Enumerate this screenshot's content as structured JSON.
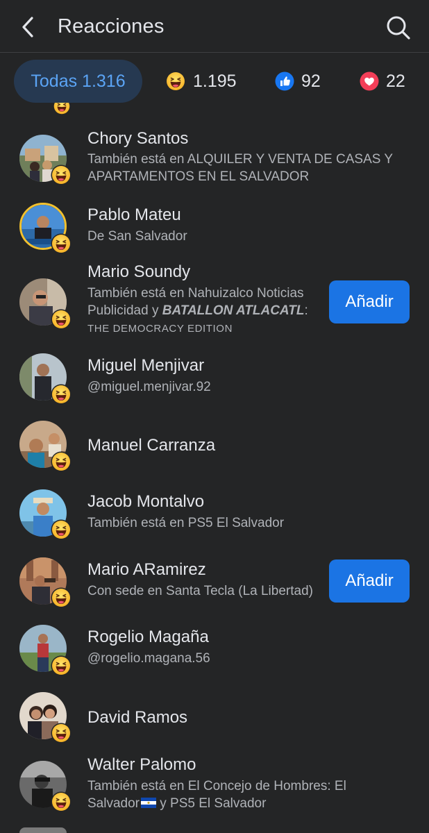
{
  "header": {
    "title": "Reacciones",
    "back_icon": "chevron-left-icon",
    "search_icon": "search-icon"
  },
  "tabs": {
    "all": {
      "label": "Todas 1.316"
    },
    "haha": {
      "count": "1.195",
      "icon": "haha-emoji-icon"
    },
    "like": {
      "count": "92",
      "icon": "like-thumb-icon"
    },
    "love": {
      "count": "22",
      "icon": "heart-icon"
    }
  },
  "colors": {
    "background": "#242526",
    "tab_active_bg": "#263951",
    "tab_active_text": "#5ba4f5",
    "button_blue": "#1b74e4",
    "secondary_text": "#b0b3b8"
  },
  "people": [
    {
      "name": "Chory Santos",
      "subtitle": "También está en ALQUILER Y VENTA DE CASAS Y APARTAMENTOS EN EL SALVADOR"
    },
    {
      "name": "Pablo Mateu",
      "subtitle": "De San Salvador"
    },
    {
      "name": "Mario Soundy",
      "subtitle_prefix": "También está en Nahuizalco Noticias Publicidad y ",
      "subtitle_bold": "BATALLON ATLACATL",
      "subtitle_suffix": ":",
      "subtitle_small": "THE DEMOCRACY EDITION",
      "button": "Añadir"
    },
    {
      "name": "Miguel Menjivar",
      "subtitle": "@miguel.menjivar.92"
    },
    {
      "name": "Manuel Carranza"
    },
    {
      "name": "Jacob Montalvo",
      "subtitle": "También está en PS5 El Salvador"
    },
    {
      "name": "Mario ARamirez",
      "subtitle": "Con sede en Santa Tecla (La Libertad)",
      "button": "Añadir"
    },
    {
      "name": "Rogelio Magaña",
      "subtitle": "@rogelio.magana.56"
    },
    {
      "name": "David Ramos"
    },
    {
      "name": "Walter Palomo",
      "subtitle_line1": "También está en El Concejo de Hombres: El",
      "subtitle_line2_a": "Salvador",
      "subtitle_line2_b": " y PS5 El Salvador"
    }
  ]
}
